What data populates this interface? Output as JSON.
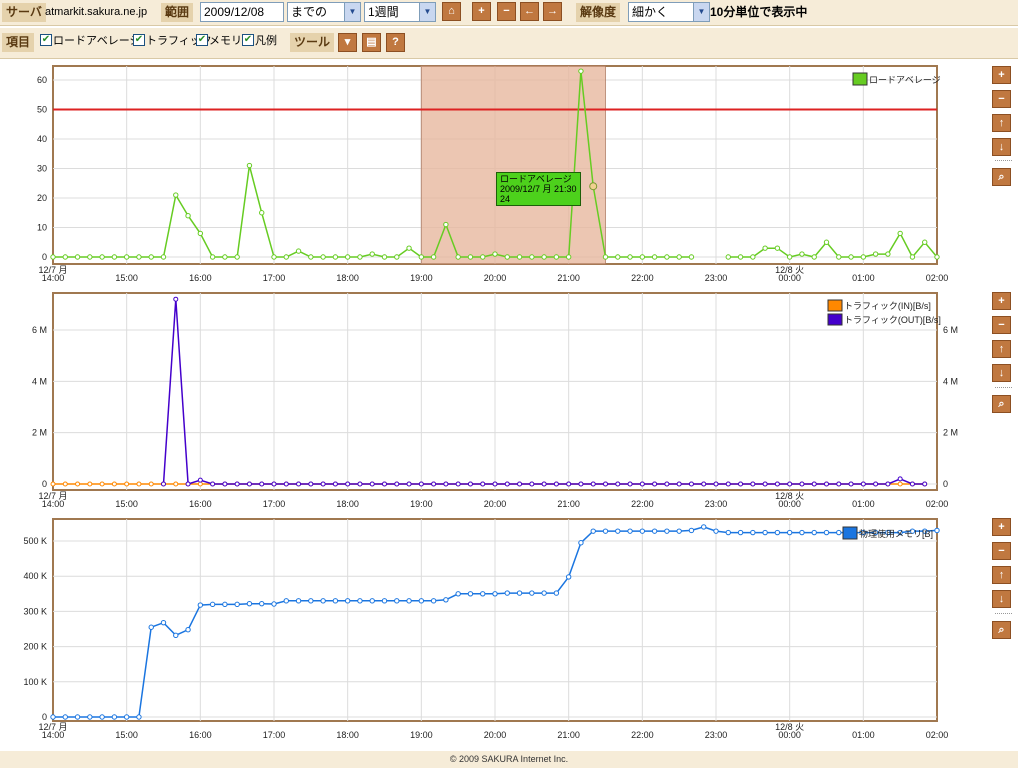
{
  "toolbar": {
    "server_label": "サーバ",
    "server_value": "atmarkit.sakura.ne.jp",
    "range_label": "範囲",
    "date_value": "2009/12/08",
    "until_option": "までの",
    "period_option": "1週間",
    "resolution_label": "解像度",
    "resolution_option": "細かく",
    "resolution_status": "10分単位で表示中"
  },
  "items": {
    "label": "項目",
    "load": "ロードアベレージ",
    "traffic": "トラフィック",
    "memory": "メモリ",
    "legend": "凡例",
    "tools_label": "ツール"
  },
  "icons": {
    "home": "home-icon",
    "zoom_in": "plus-icon",
    "zoom_out": "minus-icon",
    "prev": "arrow-left-icon",
    "next": "arrow-right-icon",
    "dropdown": "chevron-down-icon",
    "print": "print-icon",
    "help": "help-icon",
    "up": "arrow-up-icon",
    "down": "arrow-down-icon",
    "search": "magnifier-icon"
  },
  "colors": {
    "load": "#66cc22",
    "threshold": "#dd2222",
    "traffic_in": "#ff8800",
    "traffic_out": "#4400cc",
    "memory": "#1a75e0",
    "selection": "#e8b8a0",
    "frame": "#a07850"
  },
  "x_axis": {
    "ticks": [
      "14:00",
      "15:00",
      "16:00",
      "17:00",
      "18:00",
      "19:00",
      "20:00",
      "21:00",
      "22:00",
      "23:00",
      "00:00",
      "01:00",
      "02:00"
    ],
    "date_start": "12/7 月",
    "date_next": "12/8 火"
  },
  "tooltip": {
    "title": "ロードアベレージ",
    "time": "2009/12/7 月 21:30",
    "value": "24"
  },
  "footer": "© 2009 SAKURA Internet Inc.",
  "chart_data": [
    {
      "type": "line",
      "series": [
        {
          "name": "ロードアベレージ",
          "values": [
            0,
            0,
            0,
            0,
            0,
            0,
            0,
            0,
            0,
            0,
            21,
            14,
            8,
            0,
            0,
            0,
            31,
            15,
            0,
            0,
            2,
            0,
            0,
            0,
            0,
            0,
            1,
            0,
            0,
            3,
            0,
            0,
            11,
            0,
            0,
            0,
            1,
            0,
            0,
            0,
            0,
            0,
            0,
            63,
            24,
            0,
            0,
            0,
            0,
            0,
            0,
            0,
            0,
            null,
            null,
            0,
            0,
            0,
            3,
            3,
            0,
            1,
            0,
            5,
            0,
            0,
            0,
            1,
            1,
            8,
            0,
            5,
            0
          ]
        }
      ],
      "threshold": 50,
      "ylim": [
        0,
        65
      ],
      "yticks": [
        0,
        10,
        20,
        30,
        40,
        50,
        60
      ],
      "selection": [
        "19:00",
        "21:30"
      ]
    },
    {
      "type": "line",
      "series": [
        {
          "name": "トラフィック(IN)[B/s]",
          "values": [
            0,
            0,
            0,
            0,
            0,
            0,
            0,
            0,
            0,
            0,
            0,
            0,
            0,
            0,
            0,
            0,
            0,
            0,
            0,
            0,
            0,
            0,
            0,
            0,
            0,
            0,
            0,
            0,
            0,
            0,
            0,
            0,
            0,
            0,
            0,
            0,
            0,
            0,
            0,
            0,
            0,
            0,
            0,
            0,
            0,
            0,
            0,
            0,
            0,
            0,
            0,
            0,
            0,
            0,
            0,
            0,
            0,
            0,
            0,
            0,
            0,
            0,
            0,
            0,
            0,
            0,
            0,
            0,
            0,
            0,
            0,
            0
          ]
        },
        {
          "name": "トラフィック(OUT)[B/s]",
          "values": [
            null,
            null,
            null,
            null,
            null,
            null,
            null,
            null,
            null,
            0,
            7200000,
            0,
            150000,
            0,
            0,
            0,
            0,
            0,
            0,
            0,
            0,
            0,
            0,
            0,
            0,
            0,
            0,
            0,
            0,
            0,
            0,
            0,
            0,
            0,
            0,
            0,
            0,
            0,
            0,
            0,
            0,
            0,
            0,
            0,
            0,
            0,
            0,
            0,
            0,
            0,
            0,
            0,
            0,
            0,
            0,
            0,
            0,
            0,
            0,
            0,
            0,
            0,
            0,
            0,
            0,
            0,
            0,
            0,
            0,
            200000,
            0,
            0
          ]
        }
      ],
      "ylim": [
        0,
        7400000
      ],
      "yticks_left": [
        "0",
        "2 M",
        "4 M",
        "6 M"
      ],
      "yticks_right": [
        "0",
        "2 M",
        "4 M",
        "6 M"
      ]
    },
    {
      "type": "line",
      "series": [
        {
          "name": "物理使用メモリ[B]",
          "values": [
            0,
            0,
            0,
            0,
            0,
            0,
            0,
            0,
            255000,
            268000,
            232000,
            248000,
            318000,
            320000,
            320000,
            320000,
            322000,
            322000,
            321000,
            330000,
            330000,
            330000,
            330000,
            330000,
            330000,
            330000,
            330000,
            330000,
            330000,
            330000,
            330000,
            330000,
            333000,
            350000,
            350000,
            350000,
            350000,
            352000,
            352000,
            352000,
            352000,
            352000,
            398000,
            495000,
            528000,
            528000,
            528000,
            528000,
            528000,
            528000,
            528000,
            528000,
            530000,
            540000,
            528000,
            524000,
            524000,
            524000,
            524000,
            524000,
            524000,
            524000,
            524000,
            524000,
            524000,
            524000,
            524000,
            524000,
            524000,
            524000,
            528000,
            528000,
            530000
          ]
        }
      ],
      "ylim": [
        0,
        560000
      ],
      "yticks": [
        "0",
        "100 K",
        "200 K",
        "300 K",
        "400 K",
        "500 K"
      ]
    }
  ]
}
